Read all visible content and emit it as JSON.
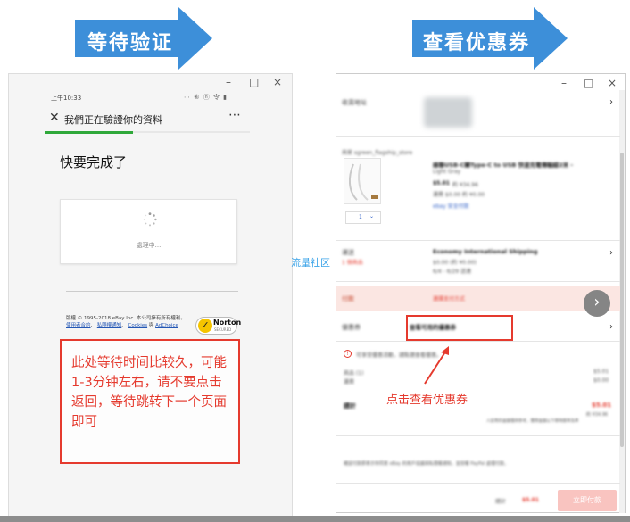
{
  "arrows": {
    "left": "等待验证",
    "right": "查看优惠券"
  },
  "colors": {
    "arrow_blue": "#3d8fd9",
    "annotation_red": "#e53a2e",
    "progress_green": "#2fa83a",
    "watermark_blue": "#3aa3e8"
  },
  "left_window": {
    "controls": {
      "minimize": "–",
      "maximize": "□",
      "close": "×"
    },
    "status_time": "上午10:33",
    "status_icons": "⋯ ⑥ ⓝ 令 ▮",
    "close_icon": "✕",
    "title": "我們正在驗證你的資料",
    "menu_icon": "⋯",
    "progress_fraction": 0.43,
    "heading": "快要完成了",
    "processing_text": "處理中...",
    "footer": {
      "copyright": "版權 © 1995-2018 eBay Inc. 本公司擁有所有權利。",
      "links": [
        "使用者合約",
        "私隱權通知",
        "Cookies",
        "AdChoice"
      ]
    },
    "norton": {
      "check": "✓",
      "name": "Norton",
      "sub": "SECURED"
    },
    "note": "此处等待时间比较久，可能1-3分钟左右，请不要点击返回，等待跳转下一个页面即可"
  },
  "right_window": {
    "controls": {
      "minimize": "–",
      "maximize": "□",
      "close": "×"
    },
    "row_address_label": "收貨地址",
    "row_item": {
      "seller_label": "商家 sgreen_flagship_store",
      "product_title": "綠聯USB-C轉Type-C to USB 快速充電傳輸線2米 -",
      "product_color": "Light Gray",
      "price": "$5.01",
      "price_note": "約 ¥34.96",
      "shipping_note": "運費 $0.00   約 ¥0.00",
      "payment_note": "ebay 安全付款",
      "qty": "1"
    },
    "row_shipping": {
      "label": "運送",
      "sub": "1 個商品",
      "method": "Economy International Shipping",
      "cost": "$0.00 (約 ¥0.00)",
      "eta": "6/4 - 6/29 送達"
    },
    "row_payment": {
      "label": "付款",
      "value": "選擇支付方式"
    },
    "row_coupon": {
      "label": "優惠券",
      "value": "查看可用的優惠券",
      "next_icon": "›"
    },
    "summary": {
      "promo_notice": "可享受優惠活動，請點選查看優惠。",
      "items_label": "商品 (1)",
      "items_value": "$5.01",
      "shipping_label": "運費",
      "shipping_value": "$0.00",
      "total_label": "總計",
      "total_value": "$5.01",
      "total_cny": "約 ¥34.96",
      "fx_note": "人民幣的金額僅供參考，實際金額以下單時匯率為準"
    },
    "terms": "確認付款即表示你同意 eBay 的用戶協議與私隱權通知，並授權 PayPal 處理付款。",
    "footer": {
      "total_label": "總計",
      "total_value": "$5.01",
      "button": "立即付款"
    }
  },
  "annotation_label": "点击查看优惠券",
  "watermark": "流量社区"
}
